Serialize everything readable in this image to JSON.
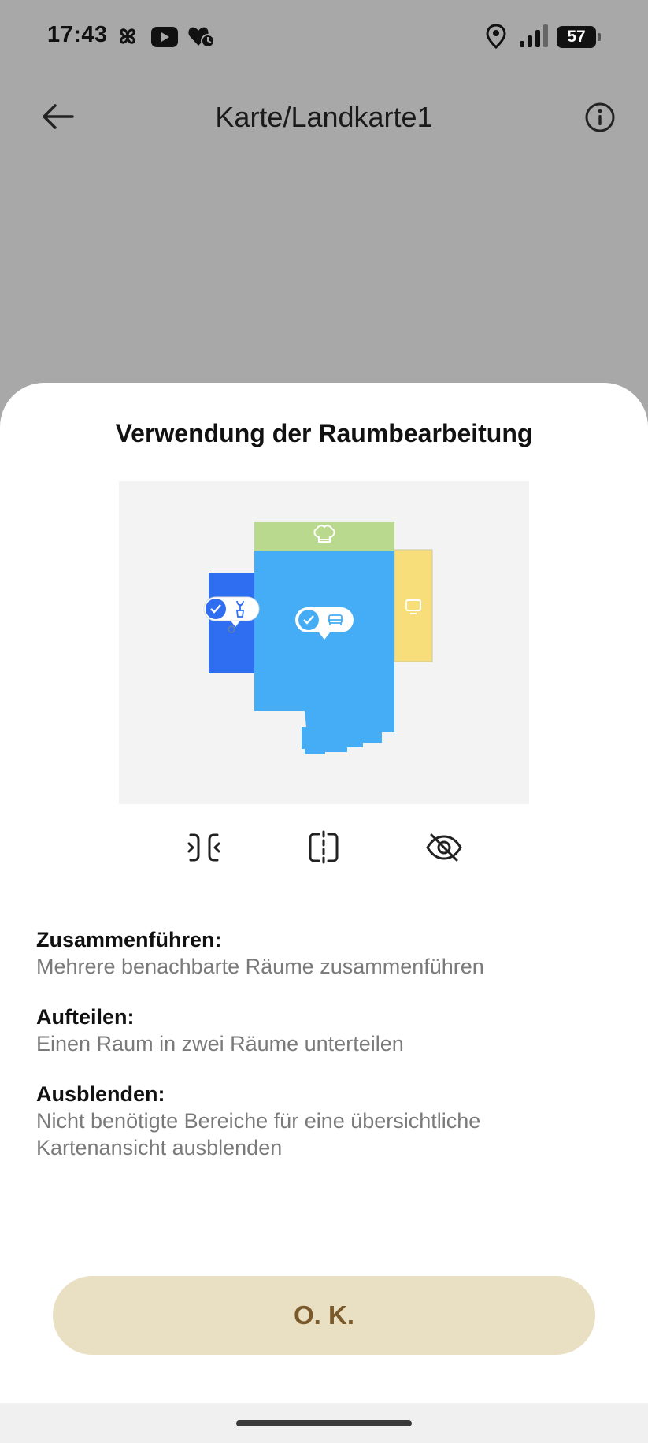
{
  "status_bar": {
    "time": "17:43",
    "battery_level": "57",
    "icons": [
      "pinwheel-icon",
      "youtube-icon",
      "health-icon",
      "location-icon",
      "signal-icon",
      "battery-icon"
    ]
  },
  "app_bar": {
    "title": "Karte/Landkarte1",
    "back_icon": "arrow-left-icon",
    "info_icon": "info-icon"
  },
  "sheet": {
    "title": "Verwendung der Raumbearbeitung",
    "tools": [
      "merge-icon",
      "split-icon",
      "hide-icon"
    ],
    "items": [
      {
        "label": "Zusammenführen:",
        "desc_lines": [
          "Mehrere benachbarte Räume zusammenführen"
        ]
      },
      {
        "label": "Aufteilen:",
        "desc_lines": [
          "Einen Raum in zwei Räume unterteilen"
        ]
      },
      {
        "label": "Ausblenden:",
        "desc_lines": [
          "Nicht benötigte Bereiche für eine übersichtliche",
          "Kartenansicht ausblenden"
        ]
      }
    ],
    "ok_label": "O. K."
  },
  "preview": {
    "rooms": [
      {
        "name": "kitchen",
        "color": "#b9d98e",
        "icon": "chef-hat-icon"
      },
      {
        "name": "living-room",
        "color": "#45adf5",
        "icon": "sofa-icon"
      },
      {
        "name": "side-room",
        "color": "#2f6ef0",
        "icon": "plant-icon"
      },
      {
        "name": "tv-room",
        "color": "#f8de7a",
        "icon": "tv-icon"
      }
    ]
  },
  "colors": {
    "overlay": "#a8a8a8",
    "button_bg": "#e9dfc3",
    "button_text": "#7a5a2b"
  }
}
